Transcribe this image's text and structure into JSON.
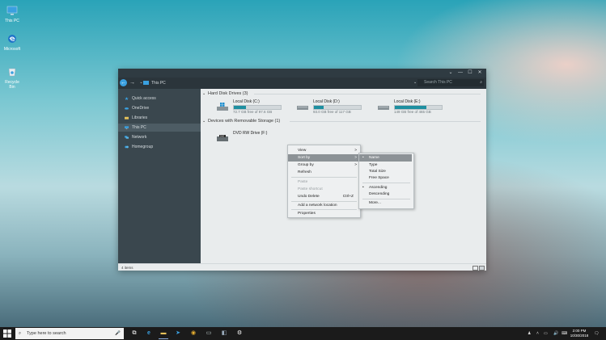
{
  "desktop": {
    "icons": [
      {
        "label": "This PC",
        "icon": "this-pc-icon"
      },
      {
        "label": "Microsoft",
        "icon": "edge-icon"
      },
      {
        "label": "Recycle Bin",
        "icon": "recycle-bin-icon"
      }
    ]
  },
  "window": {
    "controls": {
      "chevron": "⌄",
      "minimize": "—",
      "maximize": "☐",
      "close": "✕"
    },
    "address": {
      "back": "←",
      "forward": "→",
      "path": "This PC",
      "search_placeholder": "Search This PC"
    },
    "sidebar": {
      "items": [
        {
          "label": "Quick access",
          "icon": "star-icon"
        },
        {
          "label": "OneDrive",
          "icon": "cloud-icon"
        },
        {
          "label": "Libraries",
          "icon": "folder-icon"
        },
        {
          "label": "This PC",
          "icon": "computer-icon"
        },
        {
          "label": "Network",
          "icon": "network-icon"
        },
        {
          "label": "Homegroup",
          "icon": "homegroup-icon"
        }
      ]
    },
    "groups": {
      "hdd": "Hard Disk Drives (3)",
      "removable": "Devices with Removable Storage (1)"
    },
    "drives": [
      {
        "name": "Local Disk (C:)",
        "free": "72.7 GB free of 97.6 GB",
        "used_fraction": 0.26
      },
      {
        "name": "Local Disk (D:)",
        "free": "93.0 GB free of 117 GB",
        "used_fraction": 0.21
      },
      {
        "name": "Local Disk (E:)",
        "free": "149 GB free of 465 GB",
        "used_fraction": 0.68
      }
    ],
    "dvd": {
      "name": "DVD RW Drive (F:)"
    },
    "status": {
      "items": "4 items"
    }
  },
  "context_menu": {
    "items": [
      {
        "label": "View",
        "arrow": ">"
      },
      {
        "label": "Sort by",
        "arrow": ">"
      },
      {
        "label": "Group by",
        "arrow": ">"
      },
      {
        "label": "Refresh"
      },
      {
        "label": "Paste"
      },
      {
        "label": "Paste shortcut"
      },
      {
        "label": "Undo Delete",
        "shortcut": "Ctrl+Z"
      },
      {
        "label": "Add a network location"
      },
      {
        "label": "Properties"
      }
    ]
  },
  "sort_menu": {
    "items": [
      {
        "label": "Name",
        "dot": "•"
      },
      {
        "label": "Type"
      },
      {
        "label": "Total Size"
      },
      {
        "label": "Free Space"
      },
      {
        "label": "Ascending",
        "dot": "•"
      },
      {
        "label": "Descending"
      },
      {
        "label": "More..."
      }
    ]
  },
  "taskbar": {
    "search_placeholder": "Type here to search",
    "clock_time": "2:00 PM",
    "clock_date": "10/30/2018"
  },
  "colors": {
    "accent": "#1e8fa0",
    "sidebar_bg": "#3a474e",
    "titlebar_bg": "#2f3b42"
  }
}
